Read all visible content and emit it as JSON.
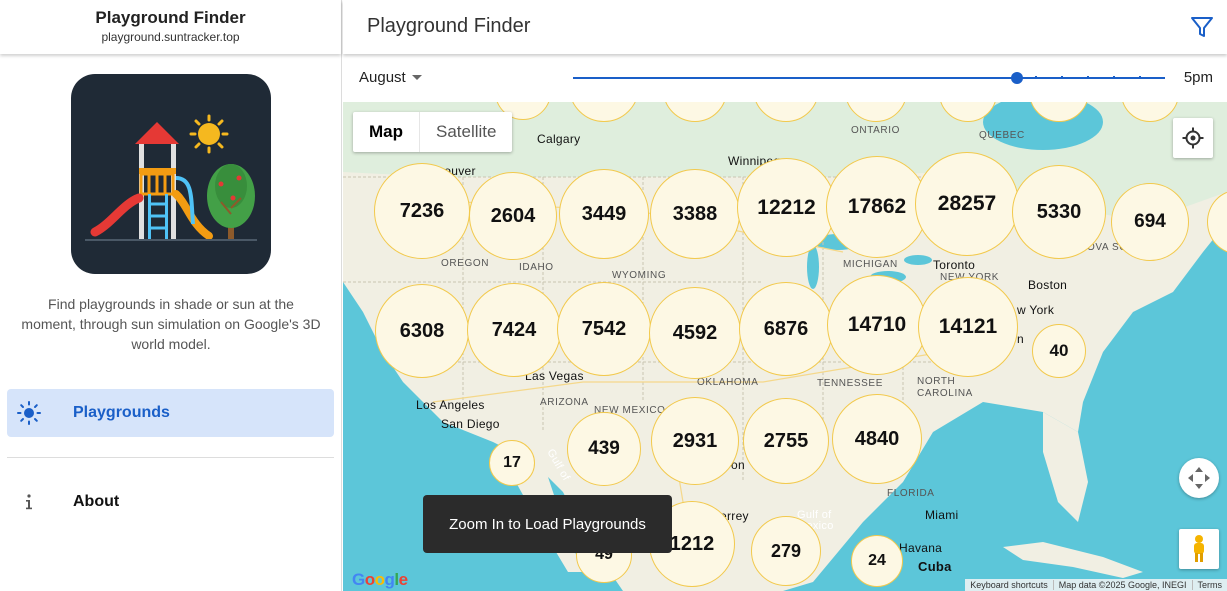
{
  "sidebar": {
    "title": "Playground Finder",
    "subtitle": "playground.suntracker.top",
    "description": "Find playgrounds in shade or sun at the moment, through sun simulation on Google's 3D world model.",
    "nav": [
      {
        "label": "Playgrounds",
        "icon": "sun-icon",
        "active": true
      },
      {
        "label": "About",
        "icon": "info-icon",
        "active": false
      }
    ]
  },
  "header": {
    "title": "Playground Finder",
    "filter_icon": "filter-icon"
  },
  "controls": {
    "month": "August",
    "time": "5pm",
    "time_fraction": 0.75
  },
  "map": {
    "type_buttons": {
      "map": "Map",
      "satellite": "Satellite"
    },
    "toast": "Zoom In to Load Playgrounds",
    "google": "Google",
    "attribution": [
      "Keyboard shortcuts",
      "Map data ©2025 Google, INEGI",
      "Terms"
    ],
    "labels": {
      "calgary": "Calgary",
      "vancouver": "ncouver",
      "winnipeg": "Winnipeg",
      "ontario": "ONTARIO",
      "quebec": "QUEBEC",
      "oregon": "OREGON",
      "idaho": "IDAHO",
      "wyoming": "WYOMING",
      "michigan": "MICHIGAN",
      "toronto": "Toronto",
      "newyork_state": "NEW YORK",
      "boston": "Boston",
      "newyork_city": "w York",
      "novascotia": "OVA SCO",
      "lasvegas": "Las Vegas",
      "losangeles": "Los Angeles",
      "sandiego": "San Diego",
      "arizona": "ARIZONA",
      "newmexico": "NEW MEXICO",
      "oklahoma": "OKLAHOMA",
      "tennessee": "TENNESSEE",
      "northcarolina": "NORTH CAROLINA",
      "florida": "FLORIDA",
      "miami": "Miami",
      "havana": "Havana",
      "cuba": "Cuba",
      "gulf_mexico": "Gulf of Mexico",
      "gulf_cal": "Gulf of",
      "terrey": "errey",
      "on": "on",
      "n": "n"
    },
    "clusters": [
      "7236",
      "2604",
      "3449",
      "3388",
      "12212",
      "17862",
      "28257",
      "5330",
      "694",
      "6308",
      "7424",
      "7542",
      "4592",
      "6876",
      "14710",
      "14121",
      "40",
      "17",
      "439",
      "2931",
      "2755",
      "4840",
      "49",
      "1212",
      "279",
      "24"
    ]
  },
  "colors": {
    "accent": "#1a5fc8",
    "cluster_fill": "#fdf8e4",
    "cluster_border": "#f2c94c",
    "water": "#5cc6d9",
    "land": "#f1efe3"
  }
}
